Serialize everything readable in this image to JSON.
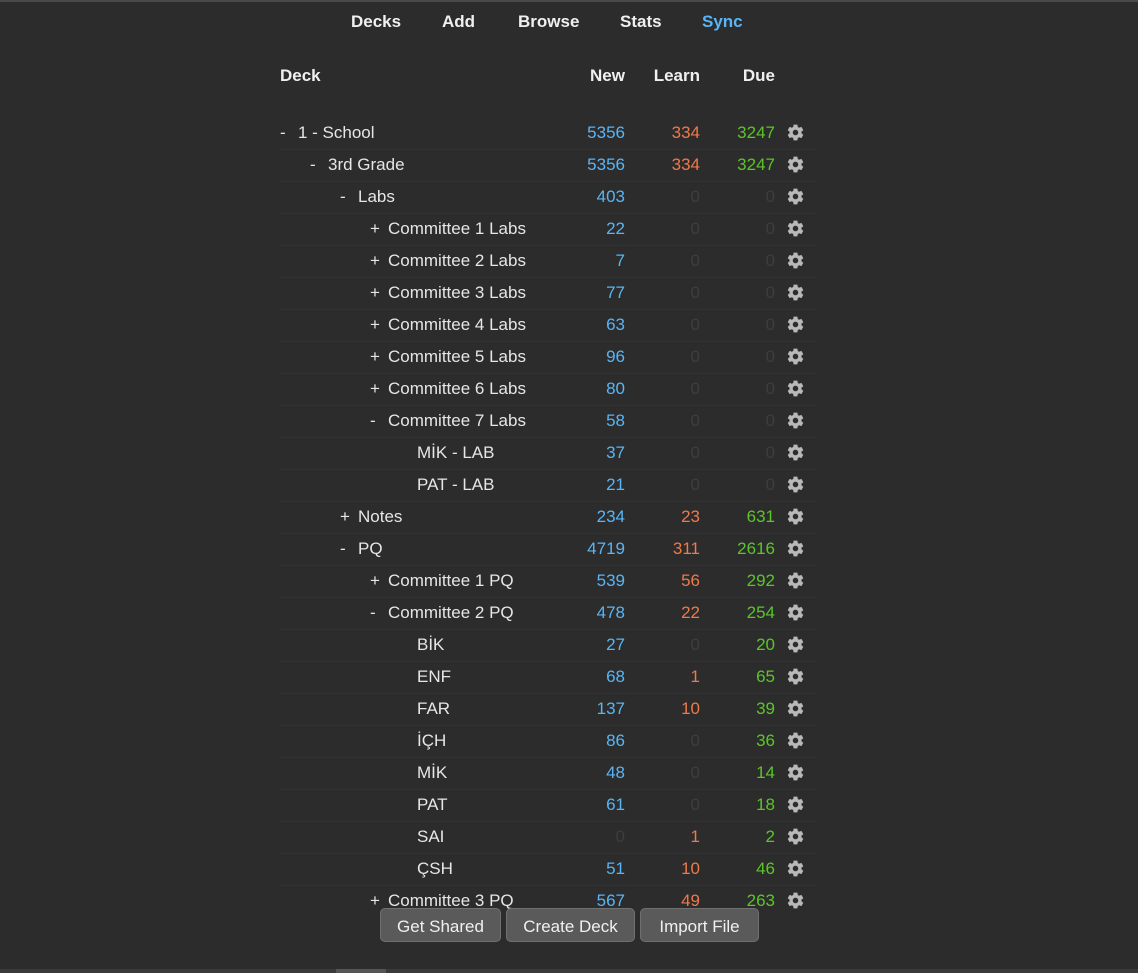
{
  "toolbar": {
    "decks": "Decks",
    "add": "Add",
    "browse": "Browse",
    "stats": "Stats",
    "sync": "Sync"
  },
  "table": {
    "headers": {
      "deck": "Deck",
      "new": "New",
      "learn": "Learn",
      "due": "Due"
    },
    "rows": [
      {
        "toggle": "-",
        "name": "1 - School",
        "depth": 0,
        "new": "5356",
        "learn": "334",
        "due": "3247"
      },
      {
        "toggle": "-",
        "name": "3rd Grade",
        "depth": 1,
        "new": "5356",
        "learn": "334",
        "due": "3247"
      },
      {
        "toggle": "-",
        "name": "Labs",
        "depth": 2,
        "new": "403",
        "learn": "0",
        "due": "0"
      },
      {
        "toggle": "+",
        "name": "Committee 1 Labs",
        "depth": 3,
        "new": "22",
        "learn": "0",
        "due": "0"
      },
      {
        "toggle": "+",
        "name": "Committee 2 Labs",
        "depth": 3,
        "new": "7",
        "learn": "0",
        "due": "0"
      },
      {
        "toggle": "+",
        "name": "Committee 3 Labs",
        "depth": 3,
        "new": "77",
        "learn": "0",
        "due": "0"
      },
      {
        "toggle": "+",
        "name": "Committee 4 Labs",
        "depth": 3,
        "new": "63",
        "learn": "0",
        "due": "0"
      },
      {
        "toggle": "+",
        "name": "Committee 5 Labs",
        "depth": 3,
        "new": "96",
        "learn": "0",
        "due": "0"
      },
      {
        "toggle": "+",
        "name": "Committee 6 Labs",
        "depth": 3,
        "new": "80",
        "learn": "0",
        "due": "0"
      },
      {
        "toggle": "-",
        "name": "Committee 7 Labs",
        "depth": 3,
        "new": "58",
        "learn": "0",
        "due": "0"
      },
      {
        "toggle": "",
        "name": "MİK - LAB",
        "depth": 4,
        "new": "37",
        "learn": "0",
        "due": "0"
      },
      {
        "toggle": "",
        "name": "PAT - LAB",
        "depth": 4,
        "new": "21",
        "learn": "0",
        "due": "0"
      },
      {
        "toggle": "+",
        "name": "Notes",
        "depth": 2,
        "new": "234",
        "learn": "23",
        "due": "631"
      },
      {
        "toggle": "-",
        "name": "PQ",
        "depth": 2,
        "new": "4719",
        "learn": "311",
        "due": "2616"
      },
      {
        "toggle": "+",
        "name": "Committee 1 PQ",
        "depth": 3,
        "new": "539",
        "learn": "56",
        "due": "292"
      },
      {
        "toggle": "-",
        "name": "Committee 2 PQ",
        "depth": 3,
        "new": "478",
        "learn": "22",
        "due": "254"
      },
      {
        "toggle": "",
        "name": "BİK",
        "depth": 4,
        "new": "27",
        "learn": "0",
        "due": "20"
      },
      {
        "toggle": "",
        "name": "ENF",
        "depth": 4,
        "new": "68",
        "learn": "1",
        "due": "65"
      },
      {
        "toggle": "",
        "name": "FAR",
        "depth": 4,
        "new": "137",
        "learn": "10",
        "due": "39"
      },
      {
        "toggle": "",
        "name": "İÇH",
        "depth": 4,
        "new": "86",
        "learn": "0",
        "due": "36"
      },
      {
        "toggle": "",
        "name": "MİK",
        "depth": 4,
        "new": "48",
        "learn": "0",
        "due": "14"
      },
      {
        "toggle": "",
        "name": "PAT",
        "depth": 4,
        "new": "61",
        "learn": "0",
        "due": "18"
      },
      {
        "toggle": "",
        "name": "SAI",
        "depth": 4,
        "new": "0",
        "learn": "1",
        "due": "2"
      },
      {
        "toggle": "",
        "name": "ÇSH",
        "depth": 4,
        "new": "51",
        "learn": "10",
        "due": "46"
      },
      {
        "toggle": "+",
        "name": "Committee 3 PQ",
        "depth": 3,
        "new": "567",
        "learn": "49",
        "due": "263"
      }
    ]
  },
  "buttons": {
    "get_shared": "Get Shared",
    "create_deck": "Create Deck",
    "import_file": "Import File"
  },
  "icons": {
    "options": "gear-icon"
  },
  "colors": {
    "background": "#2c2c2c",
    "new": "#59b5f5",
    "learn": "#f0794a",
    "due": "#5cc52a",
    "zero": "#3e3e3e",
    "sync_accent": "#59b5f5"
  }
}
